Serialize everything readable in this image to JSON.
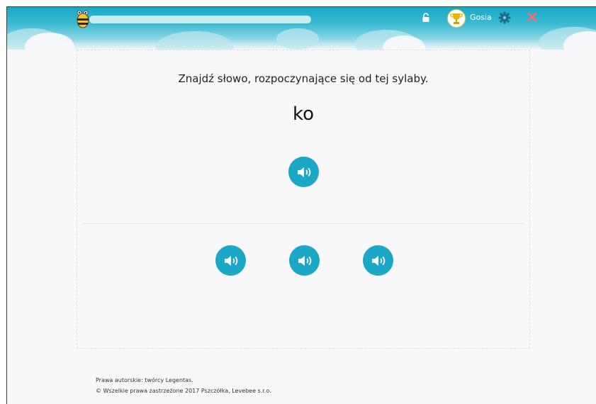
{
  "header": {
    "username": "Gosia",
    "progress": 0.0,
    "icons": [
      "bee-logo-icon",
      "lock-icon",
      "trophy-avatar-icon",
      "gear-icon",
      "close-icon"
    ]
  },
  "exercise": {
    "instruction": "Znajdź słowo, rozpoczynające się od tej sylaby.",
    "syllable": "ko",
    "prompt_button_icon": "speaker-icon",
    "answer_buttons": [
      {
        "icon": "speaker-icon"
      },
      {
        "icon": "speaker-icon"
      },
      {
        "icon": "speaker-icon"
      }
    ]
  },
  "footer": {
    "line1": "Prawa autorskie: twórcy Legentas.",
    "line2": "© Wszelkie prawa zastrzeżone 2017 Pszczółka, Levebee s.r.o."
  },
  "colors": {
    "accent": "#1ba8c7",
    "header_top": "#16a9c6",
    "close": "#e8727a",
    "background": "#f8f8fa"
  }
}
